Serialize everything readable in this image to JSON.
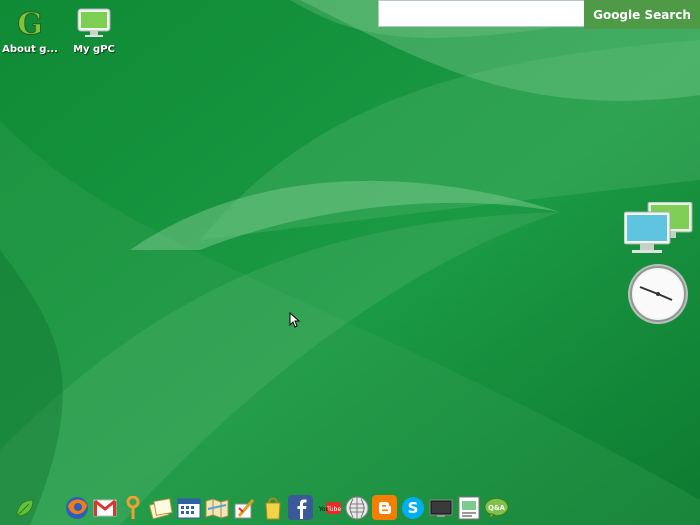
{
  "desktop": {
    "icons": [
      {
        "label": "About g...",
        "name": "about-gos-icon"
      },
      {
        "label": "My gPC",
        "name": "my-gpc-icon"
      }
    ]
  },
  "search": {
    "button_label": "Google Search",
    "placeholder": ""
  },
  "colors": {
    "bg_dark": "#0f7a34",
    "bg_light": "#5fb372",
    "search_button": "#4f9a47"
  },
  "dock": {
    "items": [
      "start-leaf-icon",
      "firefox-icon",
      "gmail-icon",
      "orkut-icon",
      "notes-icon",
      "calendar-icon",
      "maps-icon",
      "paint-icon",
      "bag-icon",
      "facebook-icon",
      "youtube-icon",
      "wikipedia-icon",
      "blogger-icon",
      "skype-icon",
      "monitor-icon",
      "docs-icon",
      "chat-icon"
    ],
    "youtube_text": "YouTube"
  }
}
